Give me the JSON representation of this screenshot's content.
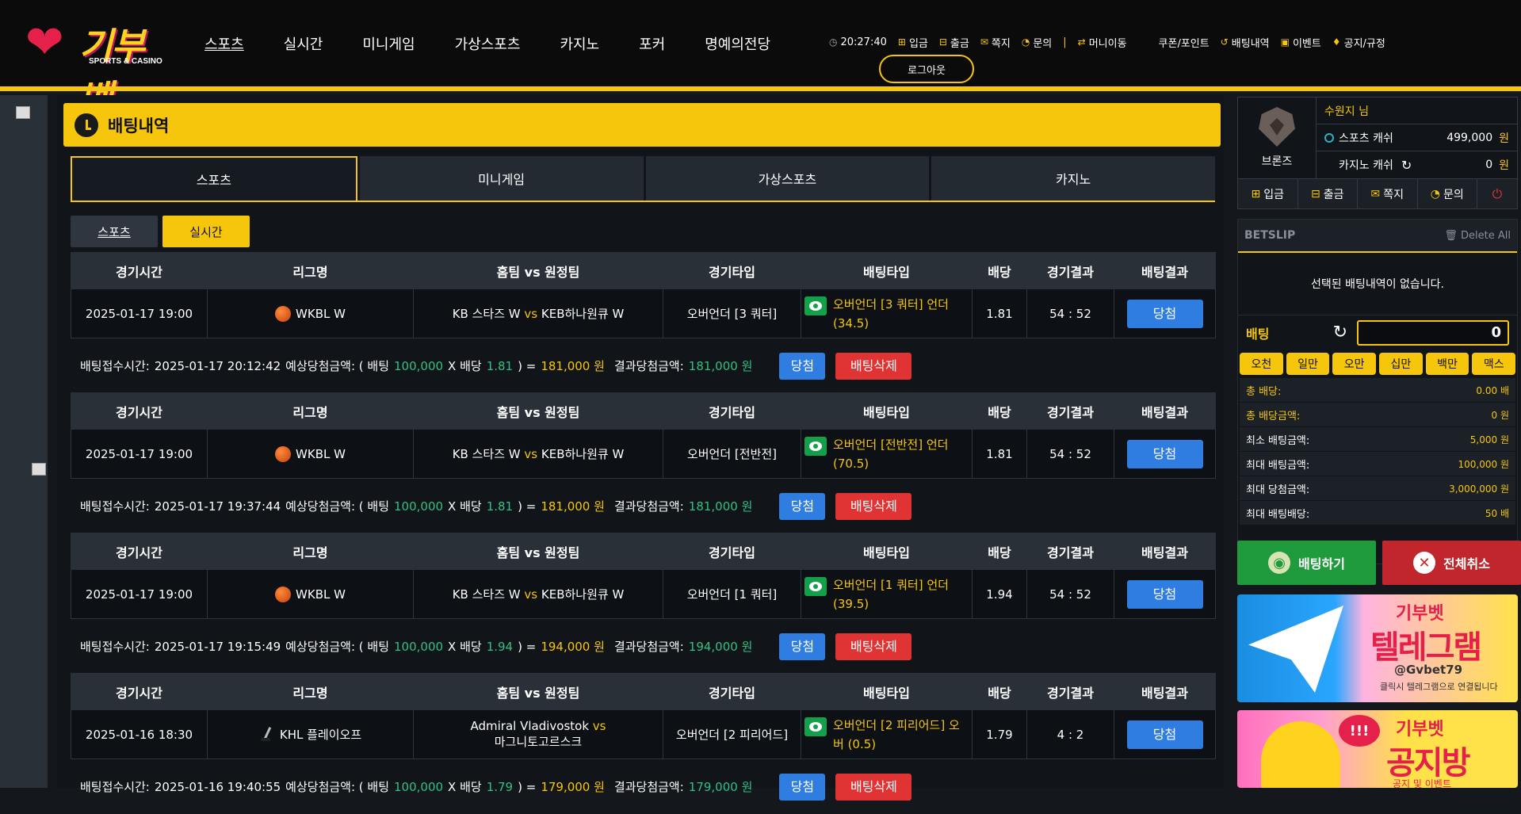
{
  "header": {
    "logo_text": "기부벳",
    "logo_sub": "SPORTS & CASINO",
    "nav": [
      "스포츠",
      "실시간",
      "미니게임",
      "가상스포츠",
      "카지노",
      "포커",
      "명예의전당"
    ],
    "time": "20:27:40",
    "links": {
      "deposit": "입금",
      "withdraw": "출금",
      "message": "쪽지",
      "inquiry": "문의",
      "money_move": "머니이동",
      "coupon": "쿠폰/포인트",
      "bet_history": "배팅내역",
      "event": "이벤트",
      "notice": "공지/규정"
    },
    "logout": "로그아웃"
  },
  "page": {
    "title": "배팅내역",
    "tabs": [
      "스포츠",
      "미니게임",
      "가상스포츠",
      "카지노"
    ],
    "subtabs": [
      "스포츠",
      "실시간"
    ]
  },
  "table_headers": [
    "경기시간",
    "리그명",
    "홈팀 vs 원정팀",
    "경기타입",
    "배팅타입",
    "배당",
    "경기결과",
    "배팅결과"
  ],
  "bets": [
    {
      "time": "2025-01-17 19:00",
      "league": "WKBL W",
      "sport_icon": "basketball-icon",
      "home": "KB 스타즈 W",
      "vs": "vs",
      "away": "KEB하나원큐 W",
      "game_type": "오버언더 [3 쿼터]",
      "bet_type": "오버언더 [3 쿼터] 언더 (34.5)",
      "odds": "1.81",
      "score": "54 : 52",
      "result": "당첨",
      "received_label": "배팅접수시간:",
      "received": "2025-01-17 20:12:42",
      "expect_label": "예상당첨금액: ( 배팅",
      "stake": "100,000",
      "x_label": "X 배당",
      "odds2": "1.81",
      "eq": ") =",
      "expect_amount": "181,000 원",
      "win_label": "결과당첨금액:",
      "win_amount": "181,000 원",
      "btn_win": "당첨",
      "btn_delete": "배팅삭제"
    },
    {
      "time": "2025-01-17 19:00",
      "league": "WKBL W",
      "sport_icon": "basketball-icon",
      "home": "KB 스타즈 W",
      "vs": "vs",
      "away": "KEB하나원큐 W",
      "game_type": "오버언더 [전반전]",
      "bet_type": "오버언더 [전반전] 언더 (70.5)",
      "odds": "1.81",
      "score": "54 : 52",
      "result": "당첨",
      "received_label": "배팅접수시간:",
      "received": "2025-01-17 19:37:44",
      "expect_label": "예상당첨금액: ( 배팅",
      "stake": "100,000",
      "x_label": "X 배당",
      "odds2": "1.81",
      "eq": ") =",
      "expect_amount": "181,000 원",
      "win_label": "결과당첨금액:",
      "win_amount": "181,000 원",
      "btn_win": "당첨",
      "btn_delete": "배팅삭제"
    },
    {
      "time": "2025-01-17 19:00",
      "league": "WKBL W",
      "sport_icon": "basketball-icon",
      "home": "KB 스타즈 W",
      "vs": "vs",
      "away": "KEB하나원큐 W",
      "game_type": "오버언더 [1 쿼터]",
      "bet_type": "오버언더 [1 쿼터] 언더 (39.5)",
      "odds": "1.94",
      "score": "54 : 52",
      "result": "당첨",
      "received_label": "배팅접수시간:",
      "received": "2025-01-17 19:15:49",
      "expect_label": "예상당첨금액: ( 배팅",
      "stake": "100,000",
      "x_label": "X 배당",
      "odds2": "1.94",
      "eq": ") =",
      "expect_amount": "194,000 원",
      "win_label": "결과당첨금액:",
      "win_amount": "194,000 원",
      "btn_win": "당첨",
      "btn_delete": "배팅삭제"
    },
    {
      "time": "2025-01-16 18:30",
      "league": "KHL 플레이오프",
      "sport_icon": "hockey-icon",
      "home": "Admiral Vladivostok",
      "vs": "vs",
      "away": "마그니토고르스크",
      "game_type": "오버언더 [2 피리어드]",
      "bet_type": "오버언더 [2 피리어드] 오버 (0.5)",
      "odds": "1.79",
      "score": "4 : 2",
      "result": "당첨",
      "received_label": "배팅접수시간:",
      "received": "2025-01-16 19:40:55",
      "expect_label": "예상당첨금액: ( 배팅",
      "stake": "100,000",
      "x_label": "X 배당",
      "odds2": "1.79",
      "eq": ") =",
      "expect_amount": "179,000 원",
      "win_label": "결과당첨금액:",
      "win_amount": "179,000 원",
      "btn_win": "당첨",
      "btn_delete": "배팅삭제"
    }
  ],
  "user": {
    "rank": "브론즈",
    "name": "수원지 님",
    "sports_cash_label": "스포츠 캐쉬",
    "sports_cash": "499,000",
    "casino_cash_label": "카지노 캐쉬",
    "casino_cash": "0",
    "currency": "원",
    "buttons": [
      "입금",
      "출금",
      "쪽지",
      "문의"
    ]
  },
  "betslip": {
    "title": "BETSLIP",
    "delete_all": "Delete All",
    "empty": "선택된 배팅내역이 없습니다.",
    "amount_label": "배팅",
    "amount_value": "0",
    "chips": [
      "오천",
      "일만",
      "오만",
      "십만",
      "백만",
      "맥스"
    ],
    "info": [
      {
        "k": "총 배당:",
        "v": "0.00 배"
      },
      {
        "k": "총 배당금액:",
        "v": "0 원"
      },
      {
        "k": "최소 배팅금액:",
        "v": "5,000 원"
      },
      {
        "k": "최대 배팅금액:",
        "v": "100,000 원"
      },
      {
        "k": "최대 당첨금액:",
        "v": "3,000,000 원"
      },
      {
        "k": "최대 배팅배당:",
        "v": "50 배"
      }
    ],
    "bet_button": "배팅하기",
    "cancel_button": "전체취소"
  },
  "banners": {
    "telegram_brand": "기부벳",
    "telegram_title": "텔레그램",
    "telegram_handle": "@Gvbet79",
    "telegram_note": "클릭시 텔레그램으로 연결됩니다",
    "notice_brand": "기부벳",
    "notice_title": "공지방",
    "notice_note": "공지 및 이벤트"
  },
  "colors": {
    "accent": "#f6c60c",
    "win_button": "#2f7de0",
    "delete_button": "#e03434",
    "green_amount": "#2fc281"
  }
}
